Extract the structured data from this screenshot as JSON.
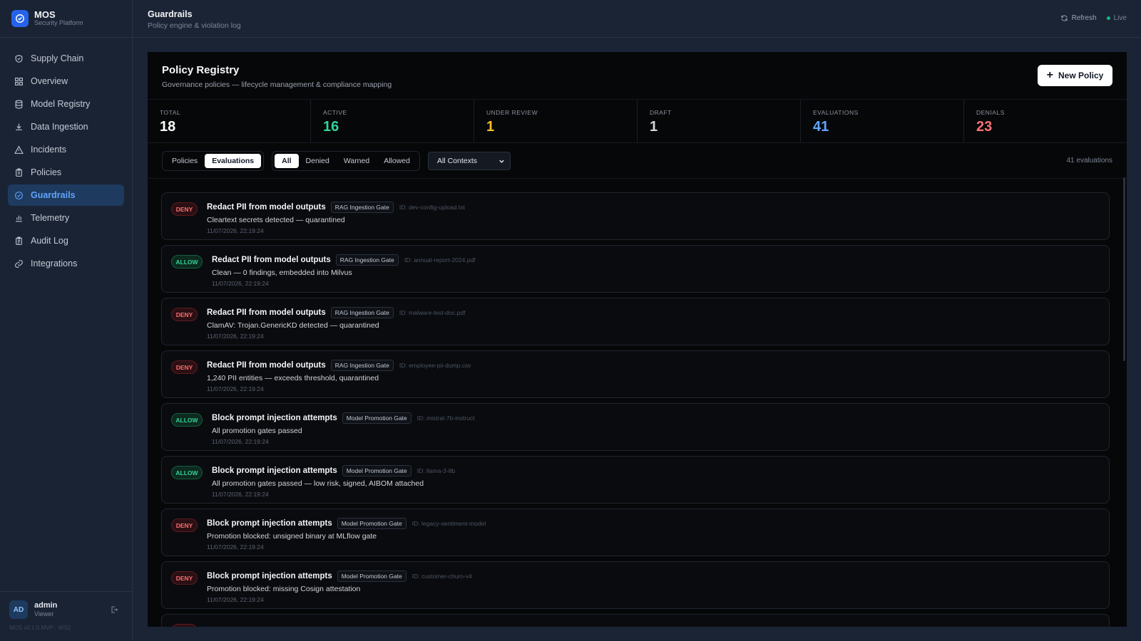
{
  "app": {
    "name": "MOS",
    "subtitle": "Security Platform",
    "version": "MOS v0.1.0 MVP · WS2"
  },
  "sidebar": {
    "items": [
      {
        "label": "Supply Chain",
        "icon": "shield-icon",
        "active": false
      },
      {
        "label": "Overview",
        "icon": "grid-icon",
        "active": false
      },
      {
        "label": "Model Registry",
        "icon": "database-icon",
        "active": false
      },
      {
        "label": "Data Ingestion",
        "icon": "download-icon",
        "active": false
      },
      {
        "label": "Incidents",
        "icon": "alert-triangle-icon",
        "active": false
      },
      {
        "label": "Policies",
        "icon": "clipboard-icon",
        "active": false
      },
      {
        "label": "Guardrails",
        "icon": "shield-check-icon",
        "active": true
      },
      {
        "label": "Telemetry",
        "icon": "bar-chart-icon",
        "active": false
      },
      {
        "label": "Audit Log",
        "icon": "clipboard-list-icon",
        "active": false
      },
      {
        "label": "Integrations",
        "icon": "link-icon",
        "active": false
      }
    ]
  },
  "user": {
    "initials": "AD",
    "name": "admin",
    "role": "Viewer"
  },
  "header": {
    "title": "Guardrails",
    "subtitle": "Policy engine & violation log",
    "refresh": "Refresh",
    "live": "Live"
  },
  "panel": {
    "title": "Policy Registry",
    "subtitle": "Governance policies — lifecycle management & compliance mapping",
    "new_button": "New Policy"
  },
  "stats": [
    {
      "label": "TOTAL",
      "value": "18",
      "color": "#ffffff"
    },
    {
      "label": "ACTIVE",
      "value": "16",
      "color": "#34d399"
    },
    {
      "label": "UNDER REVIEW",
      "value": "1",
      "color": "#fbbf24"
    },
    {
      "label": "DRAFT",
      "value": "1",
      "color": "#d1d5db"
    },
    {
      "label": "EVALUATIONS",
      "value": "41",
      "color": "#60a5fa"
    },
    {
      "label": "DENIALS",
      "value": "23",
      "color": "#f87171"
    }
  ],
  "toolbar": {
    "view_tabs": [
      {
        "label": "Policies",
        "active": false
      },
      {
        "label": "Evaluations",
        "active": true
      }
    ],
    "filters": [
      {
        "label": "All",
        "active": true
      },
      {
        "label": "Denied",
        "active": false
      },
      {
        "label": "Warned",
        "active": false
      },
      {
        "label": "Allowed",
        "active": false
      }
    ],
    "context_select": "All Contexts",
    "count": "41 evaluations"
  },
  "evaluations": [
    {
      "decision": "DENY",
      "policy": "Redact PII from model outputs",
      "gate": "RAG Ingestion Gate",
      "resource": "ID: dev-config-upload.txt",
      "message": "Cleartext secrets detected — quarantined",
      "time": "11/07/2026, 22:19:24"
    },
    {
      "decision": "ALLOW",
      "policy": "Redact PII from model outputs",
      "gate": "RAG Ingestion Gate",
      "resource": "ID: annual-report-2024.pdf",
      "message": "Clean — 0 findings, embedded into Milvus",
      "time": "11/07/2026, 22:19:24"
    },
    {
      "decision": "DENY",
      "policy": "Redact PII from model outputs",
      "gate": "RAG Ingestion Gate",
      "resource": "ID: malware-test-doc.pdf",
      "message": "ClamAV: Trojan.GenericKD detected — quarantined",
      "time": "11/07/2026, 22:19:24"
    },
    {
      "decision": "DENY",
      "policy": "Redact PII from model outputs",
      "gate": "RAG Ingestion Gate",
      "resource": "ID: employee-pii-dump.csv",
      "message": "1,240 PII entities — exceeds threshold, quarantined",
      "time": "11/07/2026, 22:19:24"
    },
    {
      "decision": "ALLOW",
      "policy": "Block prompt injection attempts",
      "gate": "Model Promotion Gate",
      "resource": "ID: mistral-7b-instruct",
      "message": "All promotion gates passed",
      "time": "11/07/2026, 22:19:24"
    },
    {
      "decision": "ALLOW",
      "policy": "Block prompt injection attempts",
      "gate": "Model Promotion Gate",
      "resource": "ID: llama-3-8b",
      "message": "All promotion gates passed — low risk, signed, AIBOM attached",
      "time": "11/07/2026, 22:19:24"
    },
    {
      "decision": "DENY",
      "policy": "Block prompt injection attempts",
      "gate": "Model Promotion Gate",
      "resource": "ID: legacy-sentiment-model",
      "message": "Promotion blocked: unsigned binary at MLflow gate",
      "time": "11/07/2026, 22:19:24"
    },
    {
      "decision": "DENY",
      "policy": "Block prompt injection attempts",
      "gate": "Model Promotion Gate",
      "resource": "ID: customer-churn-v4",
      "message": "Promotion blocked: missing Cosign attestation",
      "time": "11/07/2026, 22:19:24"
    },
    {
      "decision": "DENY",
      "policy": "",
      "gate": "",
      "resource": "",
      "message": "",
      "time": ""
    }
  ]
}
